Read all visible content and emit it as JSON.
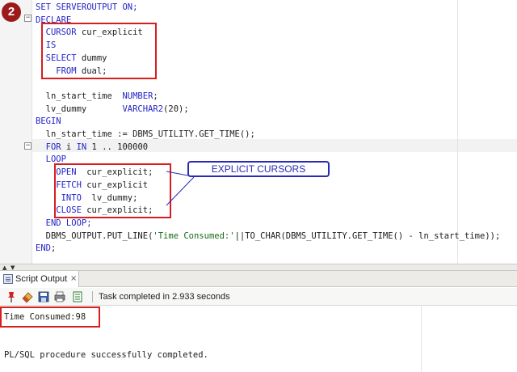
{
  "step_badge": "2",
  "code": {
    "lines": [
      [
        {
          "t": "SET SERVEROUTPUT ON;",
          "c": "kw"
        }
      ],
      [
        {
          "t": "DECLARE",
          "c": "kw"
        }
      ],
      [
        {
          "t": "  CURSOR",
          "c": "kw"
        },
        {
          "t": " cur_explicit",
          "c": ""
        }
      ],
      [
        {
          "t": "  IS",
          "c": "kw"
        }
      ],
      [
        {
          "t": "  SELECT",
          "c": "kw"
        },
        {
          "t": " dummy",
          "c": ""
        }
      ],
      [
        {
          "t": "    FROM",
          "c": "kw"
        },
        {
          "t": " dual;",
          "c": ""
        }
      ],
      [],
      [
        {
          "t": "  ln_start_time  ",
          "c": ""
        },
        {
          "t": "NUMBER",
          "c": "kw"
        },
        {
          "t": ";",
          "c": ""
        }
      ],
      [
        {
          "t": "  lv_dummy       ",
          "c": ""
        },
        {
          "t": "VARCHAR2",
          "c": "kw"
        },
        {
          "t": "(20);",
          "c": ""
        }
      ],
      [
        {
          "t": "BEGIN",
          "c": "kw"
        }
      ],
      [
        {
          "t": "  ln_start_time := DBMS_UTILITY.GET_TIME();",
          "c": ""
        }
      ],
      [
        {
          "t": "  FOR",
          "c": "kw"
        },
        {
          "t": " i ",
          "c": ""
        },
        {
          "t": "IN",
          "c": "kw"
        },
        {
          "t": " 1 .. 100000",
          "c": ""
        }
      ],
      [
        {
          "t": "  LOOP",
          "c": "kw"
        }
      ],
      [
        {
          "t": "    OPEN",
          "c": "kw"
        },
        {
          "t": "  cur_explicit;",
          "c": ""
        }
      ],
      [
        {
          "t": "    FETCH",
          "c": "kw"
        },
        {
          "t": " cur_explicit",
          "c": ""
        }
      ],
      [
        {
          "t": "     INTO",
          "c": "kw"
        },
        {
          "t": "  lv_dummy;",
          "c": ""
        }
      ],
      [
        {
          "t": "    CLOSE",
          "c": "kw"
        },
        {
          "t": " cur_explicit;",
          "c": ""
        }
      ],
      [
        {
          "t": "  END LOOP;",
          "c": "kw"
        }
      ],
      [
        {
          "t": "  DBMS_OUTPUT.PUT_LINE(",
          "c": ""
        },
        {
          "t": "'Time Consumed:'",
          "c": "str"
        },
        {
          "t": "||TO_CHAR(DBMS_UTILITY.GET_TIME() - ln_start_time));",
          "c": ""
        }
      ],
      [
        {
          "t": "END",
          "c": "kw"
        },
        {
          "t": ";",
          "c": ""
        }
      ]
    ]
  },
  "callout": {
    "label": "EXPLICIT CURSORS"
  },
  "splitter": {
    "up": "▲",
    "down": "▼"
  },
  "output_panel": {
    "tab_label": "Script Output",
    "tab_close": "×",
    "status_text": "Task completed in 2.933 seconds",
    "toolbar_icons": [
      "pin-icon",
      "eraser-icon",
      "save-icon",
      "print-icon",
      "open-file-icon"
    ],
    "lines": [
      "Time Consumed:98",
      "",
      "",
      "PL/SQL procedure successfully completed."
    ]
  }
}
